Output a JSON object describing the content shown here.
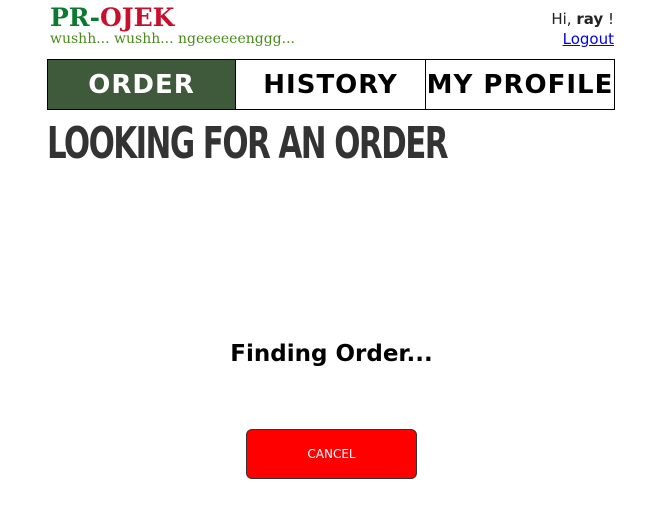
{
  "header": {
    "logo": {
      "pr": "PR",
      "dash": "-",
      "ojek": "OJEK"
    },
    "tagline": "wushh... wushh... ngeeeeeenggg...",
    "greeting": {
      "prefix": "Hi,",
      "username": "ray",
      "suffix": "!"
    },
    "logout_label": "Logout"
  },
  "nav": {
    "tabs": [
      {
        "label": "ORDER",
        "active": true
      },
      {
        "label": "HISTORY",
        "active": false
      },
      {
        "label": "MY PROFILE",
        "active": false
      }
    ]
  },
  "main": {
    "title": "LOOKING FOR AN ORDER",
    "status": "Finding Order...",
    "cancel_label": "CANCEL"
  },
  "colors": {
    "brand_green": "#0b7a2e",
    "brand_red": "#c8102e",
    "active_tab": "#3f5a3a",
    "cancel_button": "#ff0000"
  }
}
